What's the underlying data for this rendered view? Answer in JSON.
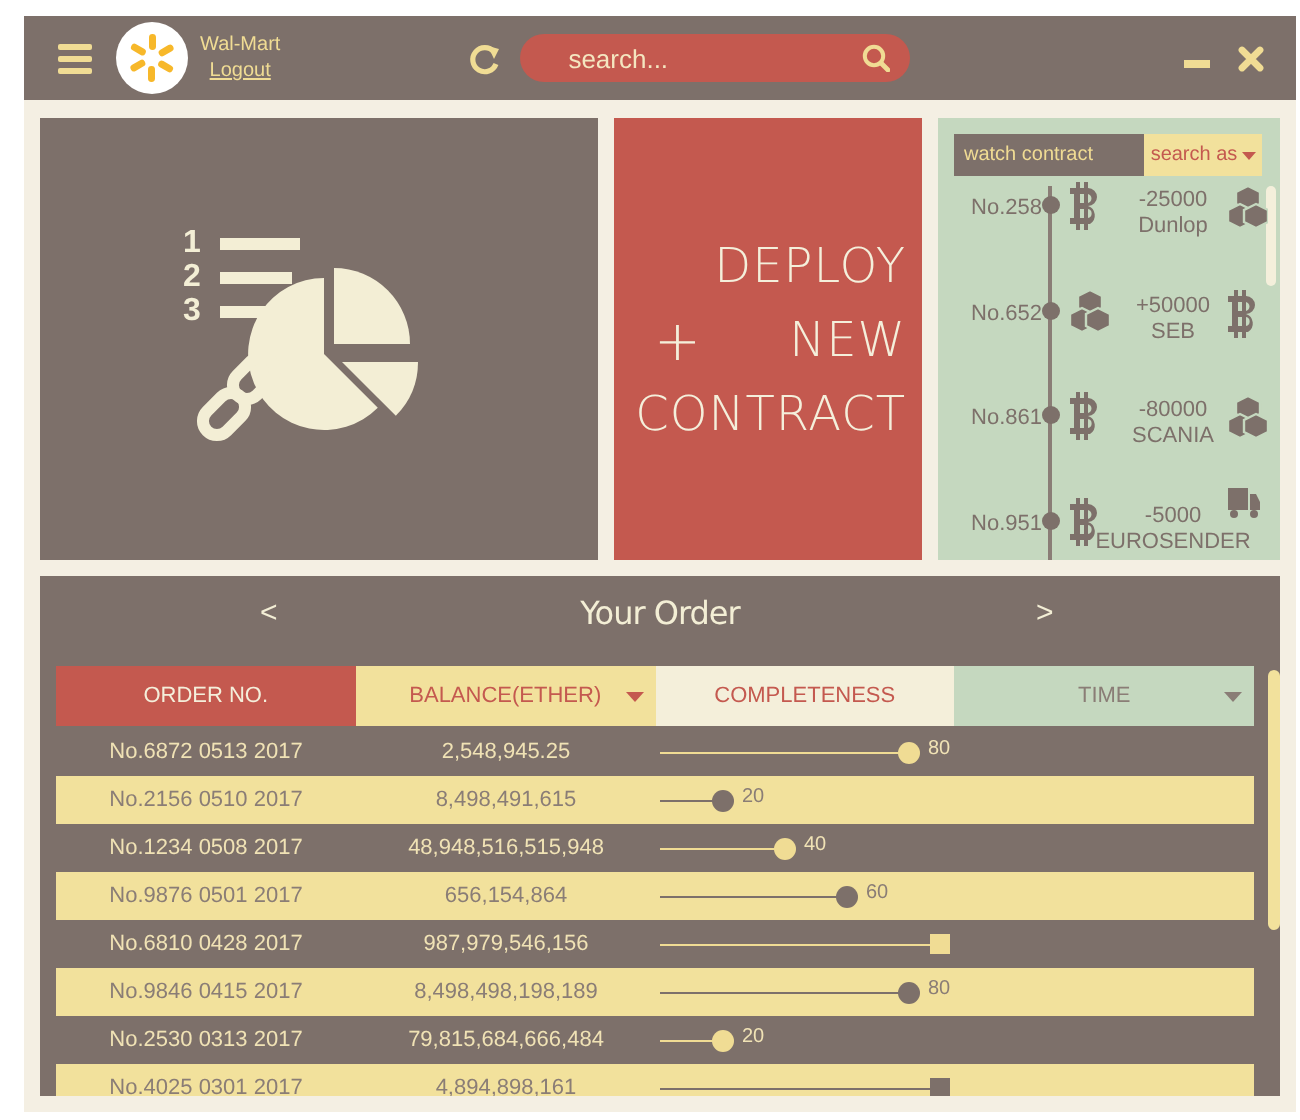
{
  "header": {
    "store": "Wal-Mart",
    "logout": "Logout",
    "search": {
      "placeholder": "search..."
    }
  },
  "hero": {
    "list_numbers": [
      "1",
      "2",
      "3"
    ]
  },
  "deploy": {
    "plus": "+",
    "lines": [
      "DEPLOY",
      "NEW",
      "CONTRACT"
    ]
  },
  "watch": {
    "field": {
      "value": "watch contract"
    },
    "dropdown": "search as",
    "items": [
      {
        "number": "No.258",
        "left_icon": {
          "kind": "bitcoin"
        },
        "amount": "-25000",
        "name": "Dunlop",
        "right_icon": {
          "kind": "blocks"
        }
      },
      {
        "number": "No.652",
        "left_icon": {
          "kind": "blocks"
        },
        "amount": "+50000",
        "name": "SEB",
        "right_icon": {
          "kind": "bitcoin"
        }
      },
      {
        "number": "No.861",
        "left_icon": {
          "kind": "bitcoin"
        },
        "amount": "-80000",
        "name": "SCANIA",
        "right_icon": {
          "kind": "blocks"
        }
      },
      {
        "number": "No.951",
        "left_icon": {
          "kind": "bitcoin"
        },
        "amount": "-5000",
        "name": "EUROSENDER",
        "right_icon": {
          "kind": "truck"
        }
      }
    ]
  },
  "orders": {
    "title": "Your Order",
    "prev": "<",
    "next": ">",
    "columns": [
      {
        "label": "ORDER NO.",
        "dropdown": false
      },
      {
        "label": "BALANCE(ETHER)",
        "dropdown": true
      },
      {
        "label": "COMPLETENESS",
        "dropdown": false
      },
      {
        "label": "TIME",
        "dropdown": true
      }
    ],
    "rows": [
      {
        "order": "No.6872 0513 2017",
        "balance": "2,548,945.25",
        "level": 0.8,
        "percent": "80",
        "kind": "progress"
      },
      {
        "order": "No.2156 0510 2017",
        "balance": "8,498,491,615",
        "level": 0.2,
        "percent": "20",
        "kind": "progress"
      },
      {
        "order": "No.1234 0508 2017",
        "balance": "48,948,516,515,948",
        "level": 0.4,
        "percent": "40",
        "kind": "progress"
      },
      {
        "order": "No.9876 0501 2017",
        "balance": "656,154,864",
        "level": 0.6,
        "percent": "60",
        "kind": "progress"
      },
      {
        "order": "No.6810 0428 2017",
        "balance": "987,979,546,156",
        "level": 0.9,
        "kind": "stopped"
      },
      {
        "order": "No.9846 0415 2017",
        "balance": "8,498,498,198,189",
        "level": 0.8,
        "percent": "80",
        "kind": "progress"
      },
      {
        "order": "No.2530 0313 2017",
        "balance": "79,815,684,666,484",
        "level": 0.2,
        "percent": "20",
        "kind": "progress"
      },
      {
        "order": "No.4025 0301 2017",
        "balance": "4,894,898,161",
        "level": 0.9,
        "kind": "stopped"
      }
    ]
  }
}
